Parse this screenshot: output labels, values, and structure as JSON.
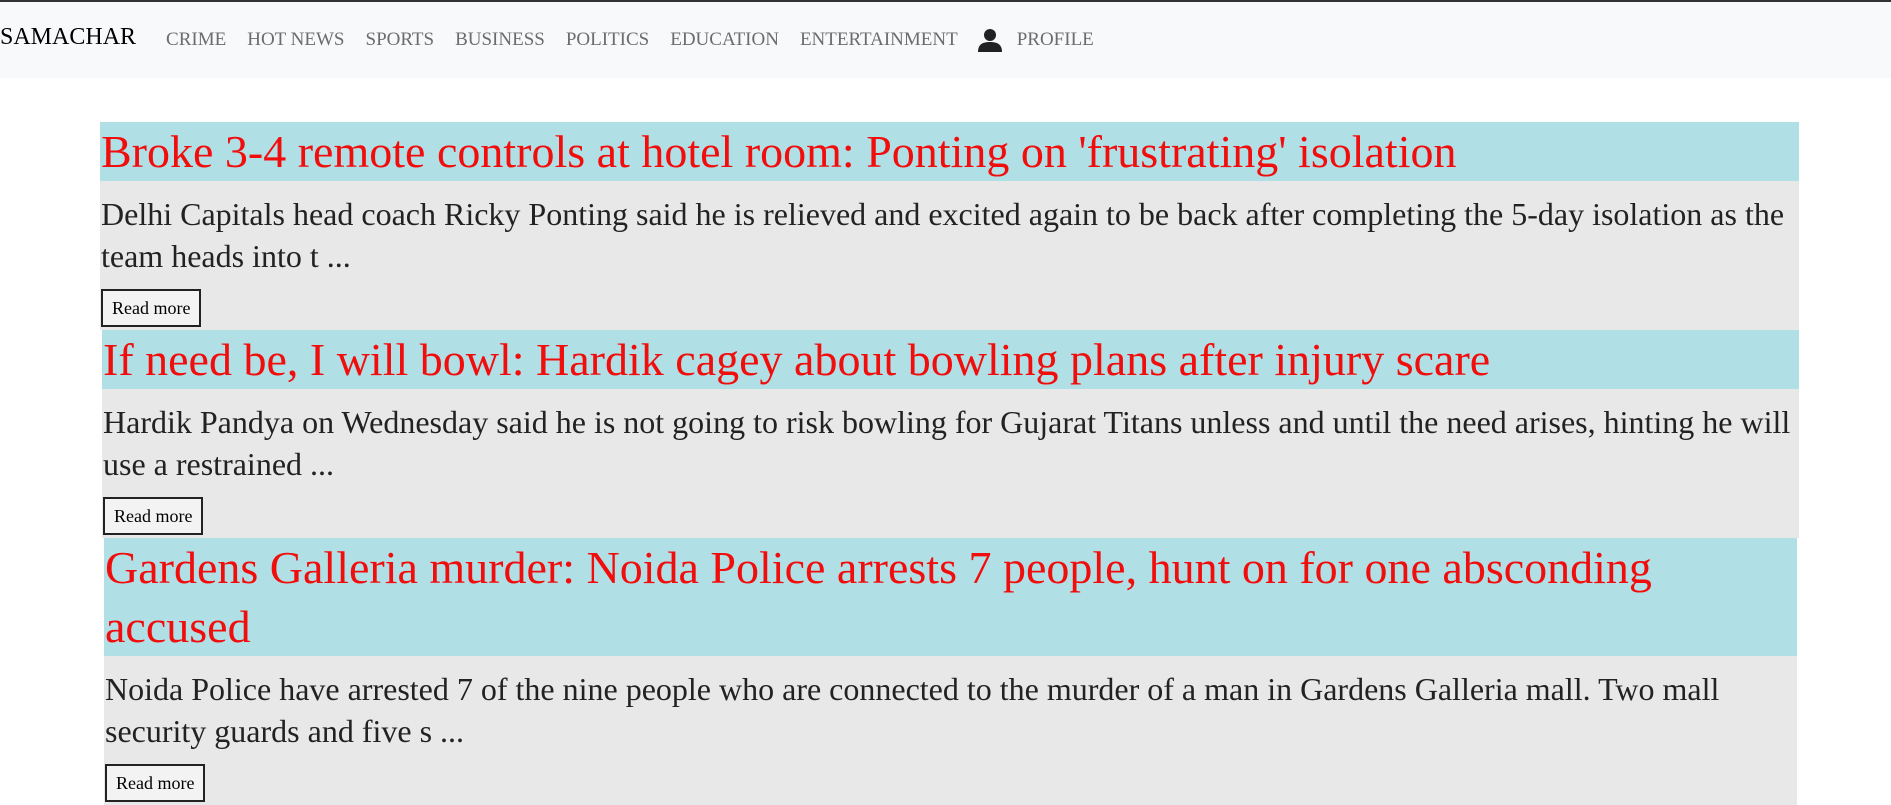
{
  "navbar": {
    "brand": "SAMACHAR",
    "links": [
      "CRIME",
      "HOT NEWS",
      "SPORTS",
      "BUSINESS",
      "POLITICS",
      "EDUCATION",
      "ENTERTAINMENT"
    ],
    "profile_icon": "person-icon",
    "profile_label": "PROFILE"
  },
  "colors": {
    "navbar_bg": "#f8f9fa",
    "title_bg": "#b0dfe5",
    "title_text": "#f20d0d",
    "card_bg": "#e8e8e8"
  },
  "articles": [
    {
      "title": "Broke 3-4 remote controls at hotel room: Ponting on 'frustrating' isolation",
      "description": "Delhi Capitals head coach Ricky Ponting said he is relieved and excited again to be back after completing the 5-day isolation as the team heads into t ...",
      "button_label": "Read more"
    },
    {
      "title": "If need be, I will bowl: Hardik cagey about bowling plans after injury scare",
      "description": "Hardik Pandya on Wednesday said he is not going to risk bowling for Gujarat Titans unless and until the need arises, hinting he will use a restrained ...",
      "button_label": "Read more"
    },
    {
      "title": "Gardens Galleria murder: Noida Police arrests 7 people, hunt on for one absconding accused",
      "description": "Noida Police have arrested 7 of the nine people who are connected to the murder of a man in Gardens Galleria mall. Two mall security guards and five s ...",
      "button_label": "Read more"
    }
  ]
}
